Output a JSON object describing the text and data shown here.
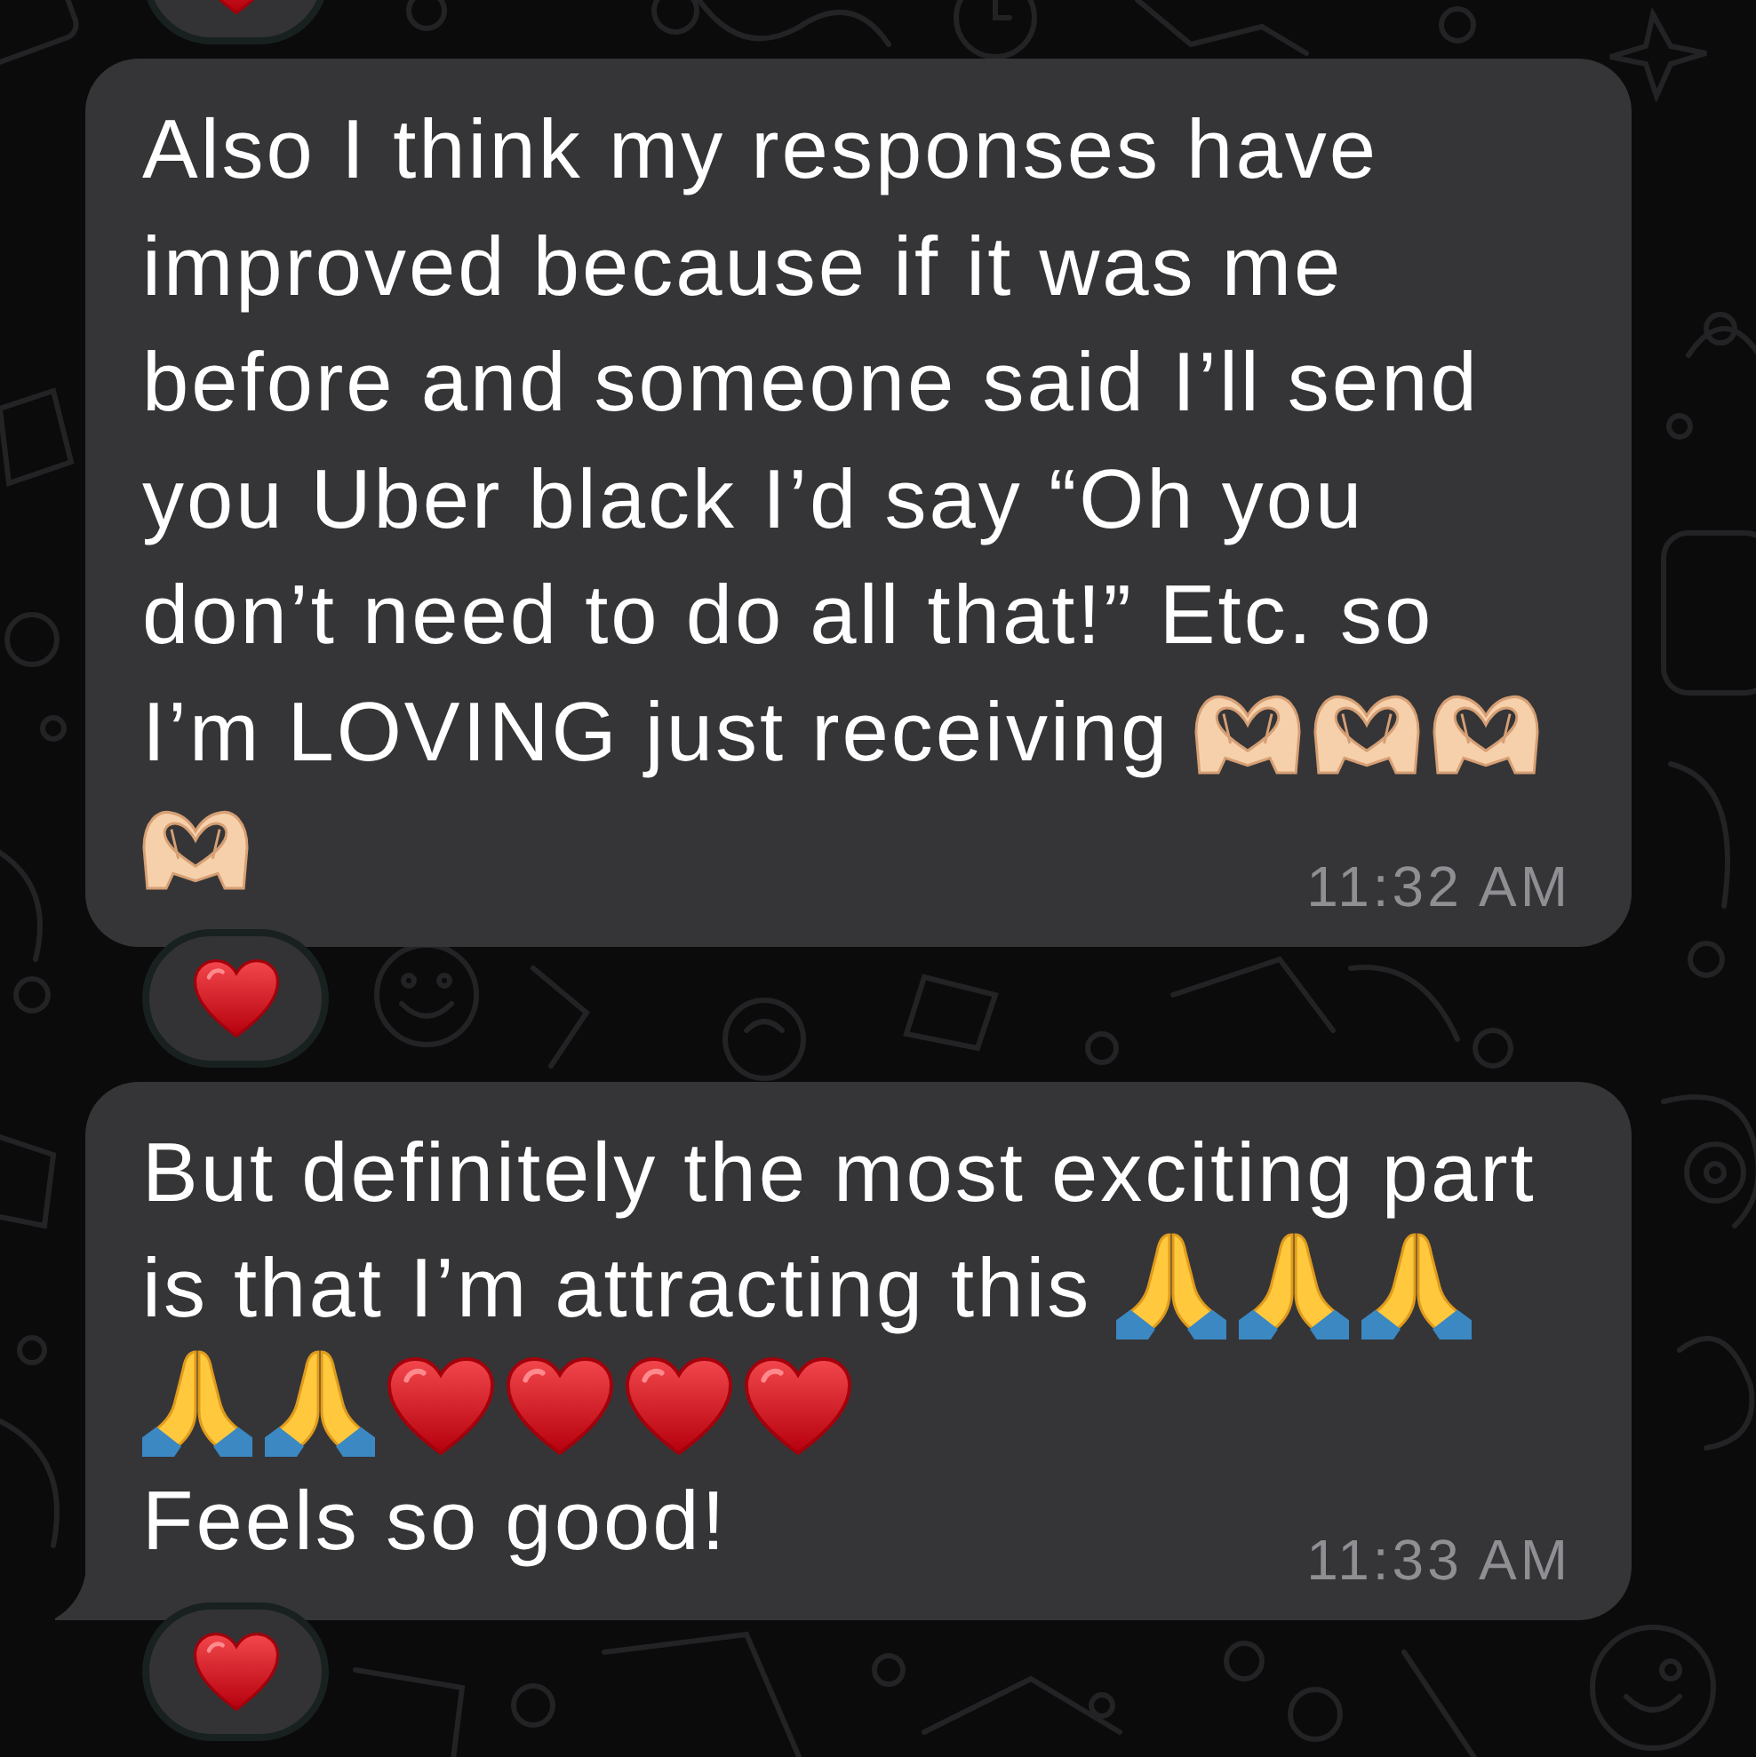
{
  "chat": {
    "previous_reaction": {
      "kind": "heart"
    },
    "messages": [
      {
        "body": [
          {
            "kind": "text",
            "text": "Also I think my responses have improved because if it was me before and someone said I’ll send you Uber black I’d say “Oh you don’t need to do all that!” Etc. so"
          },
          {
            "kind": "line_break"
          },
          {
            "kind": "text",
            "text": "I’m LOVING just receiving"
          },
          {
            "kind": "heart_hands"
          },
          {
            "kind": "heart_hands"
          },
          {
            "kind": "heart_hands"
          },
          {
            "kind": "heart_hands"
          }
        ],
        "time": "11:32 AM",
        "tail": false,
        "reaction": {
          "kind": "heart"
        }
      },
      {
        "body": [
          {
            "kind": "text",
            "text": "But definitely the most exciting part"
          },
          {
            "kind": "line_break"
          },
          {
            "kind": "text",
            "text": "is that I’m attracting this"
          },
          {
            "kind": "pray"
          },
          {
            "kind": "pray"
          },
          {
            "kind": "pray"
          },
          {
            "kind": "pray"
          },
          {
            "kind": "pray"
          },
          {
            "kind": "heart"
          },
          {
            "kind": "heart"
          },
          {
            "kind": "heart"
          },
          {
            "kind": "heart"
          },
          {
            "kind": "line_break"
          },
          {
            "kind": "text",
            "text": "Feels so good!"
          }
        ],
        "time": "11:33 AM",
        "tail": true,
        "reaction": {
          "kind": "heart"
        }
      }
    ]
  }
}
